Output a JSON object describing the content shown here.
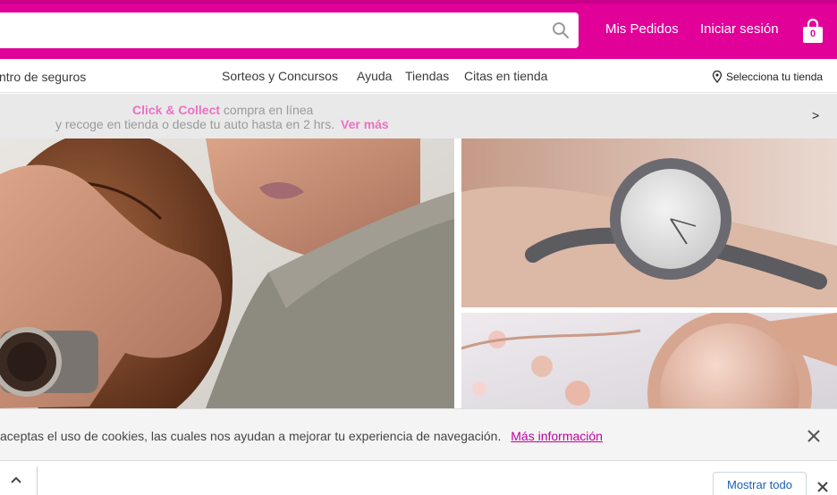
{
  "header": {
    "search_placeholder": "",
    "search_value": "",
    "orders_label": "Mis Pedidos",
    "login_label": "Iniciar sesión",
    "cart_count": "0",
    "brand_color": "#e10098"
  },
  "nav": {
    "insurance_label": "ntro de seguros",
    "raffles_label": "Sorteos y Concursos",
    "help_label": "Ayuda",
    "stores_label": "Tiendas",
    "appointments_label": "Citas en tienda",
    "select_store_label": "Selecciona tu tienda"
  },
  "promo": {
    "brand": "Click & Collect",
    "line1_rest": "compra en línea",
    "line2": "y recoge en tienda o desde tu auto hasta en 2 hrs.",
    "more_link": "Ver más",
    "arrow": ">"
  },
  "hero": {
    "left_image": "man holding football wearing wristwatch",
    "right_top_image": "woman wrist with silver watch",
    "right_bottom_image": "rose gold watch and jewelry"
  },
  "cookies": {
    "message": "aceptas el uso de cookies, las cuales nos ayudan a mejorar tu experiencia de navegación.",
    "more_link": "Más información"
  },
  "downloads": {
    "show_all_label": "Mostrar todo"
  }
}
